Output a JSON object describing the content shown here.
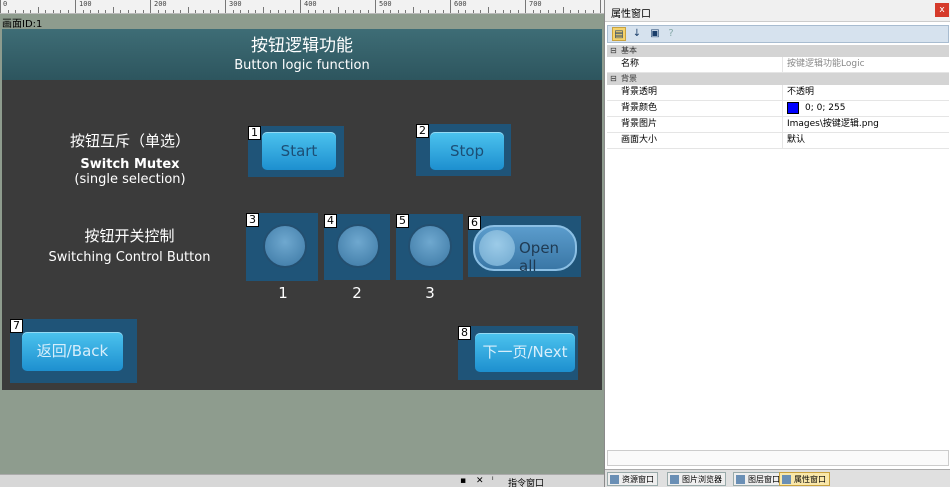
{
  "editor": {
    "screen_id": "画面ID:1",
    "ruler_labels": [
      "0",
      "100",
      "200",
      "300",
      "400",
      "500",
      "600",
      "700"
    ],
    "status_text": "指令窗口"
  },
  "screen": {
    "title": "按钮逻辑功能",
    "subtitle": "Button logic function",
    "mutex_label_cn": "按钮互斥（单选）",
    "mutex_label_en1": "Switch Mutex",
    "mutex_label_en2": "(single selection)",
    "switch_label_cn": "按钮开关控制",
    "switch_label_en": "Switching Control Button",
    "buttons": [
      {
        "num": "1",
        "label": "Start"
      },
      {
        "num": "2",
        "label": "Stop"
      },
      {
        "num": "3",
        "label": "1"
      },
      {
        "num": "4",
        "label": "2"
      },
      {
        "num": "5",
        "label": "3"
      },
      {
        "num": "6",
        "label": "Open all"
      },
      {
        "num": "7",
        "label": "返回/Back"
      },
      {
        "num": "8",
        "label": "下一页/Next"
      }
    ]
  },
  "panel": {
    "title": "属性窗口",
    "close": "x",
    "categories": [
      {
        "name": "基本",
        "rows": [
          {
            "key": "名称",
            "value": "按键逻辑功能Logic"
          }
        ]
      },
      {
        "name": "背景",
        "rows": [
          {
            "key": "背景透明",
            "value": "不透明"
          },
          {
            "key": "背景颜色",
            "value": "0; 0; 255"
          },
          {
            "key": "背景图片",
            "value": "Images\\按键逻辑.png"
          },
          {
            "key": "画面大小",
            "value": "默认"
          }
        ]
      }
    ],
    "tabs": [
      "资源窗口",
      "图片浏览器",
      "图层窗口",
      "属性窗口"
    ]
  },
  "colors": {
    "background_color": "#0000ff",
    "accent": "#1d8fcf"
  }
}
